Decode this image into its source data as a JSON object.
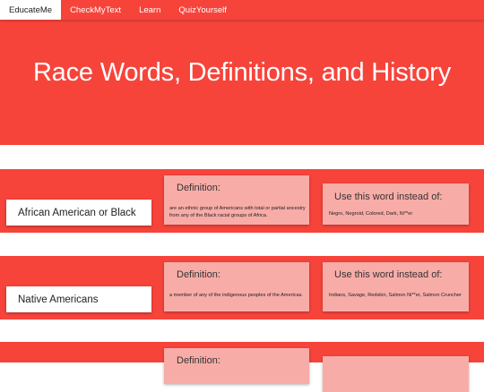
{
  "nav": {
    "items": [
      {
        "label": "EducateMe"
      },
      {
        "label": "CheckMyText"
      },
      {
        "label": "Learn"
      },
      {
        "label": "QuizYourself"
      }
    ]
  },
  "hero": {
    "title": "Race Words, Definitions, and History"
  },
  "words": [
    {
      "term": "African American or Black",
      "definition_heading": "Definition:",
      "definition": "are an ethnic group of Americans with total or partial ancestry from any of the Black racial groups of Africa.",
      "alternatives_heading": "Use this word instead of:",
      "alternatives": "Negro, Negroid, Colored, Dark, Ni**er"
    },
    {
      "term": "Native Americans",
      "definition_heading": "Definition:",
      "definition": "a member of any of the indigenous peoples of the Americas.",
      "alternatives_heading": "Use this word instead of:",
      "alternatives": "Indians, Savage, Redskin, Salmon Ni**er, Salmon Cruncher"
    },
    {
      "definition_heading": "Definition:"
    }
  ],
  "colors": {
    "primary_red": "#f6443b",
    "card_pink": "#f8aca7",
    "white": "#ffffff"
  }
}
